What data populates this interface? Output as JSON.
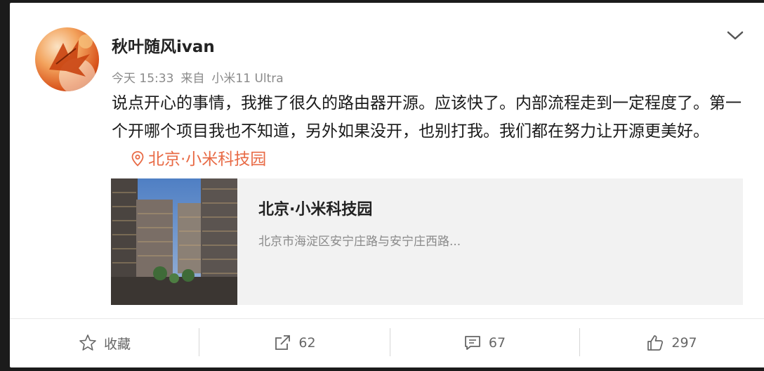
{
  "post": {
    "author": "秋叶随风ivan",
    "time": "今天 15:33",
    "source_prefix": "来自",
    "source_device": "小米11 Ultra",
    "text": "说点开心的事情，我推了很久的路由器开源。应该快了。内部流程走到一定程度了。第一个开哪个项目我也不知道，另外如果没开，也别打我。我们都在努力让开源更美好。",
    "location_inline": "北京·小米科技园"
  },
  "place_card": {
    "title": "北京·小米科技园",
    "address": "北京市海淀区安宁庄路与安宁庄西路..."
  },
  "actions": {
    "favorite_label": "收藏",
    "repost_count": "62",
    "comment_count": "67",
    "like_count": "297"
  },
  "icons": {
    "more": "chevron-down-icon",
    "location": "location-pin-icon",
    "favorite": "star-icon",
    "repost": "share-icon",
    "comment": "comment-icon",
    "like": "thumbs-up-icon"
  },
  "colors": {
    "location_accent": "#e86a45",
    "meta_text": "#8a8a8a",
    "card_bg": "#f2f2f2"
  }
}
